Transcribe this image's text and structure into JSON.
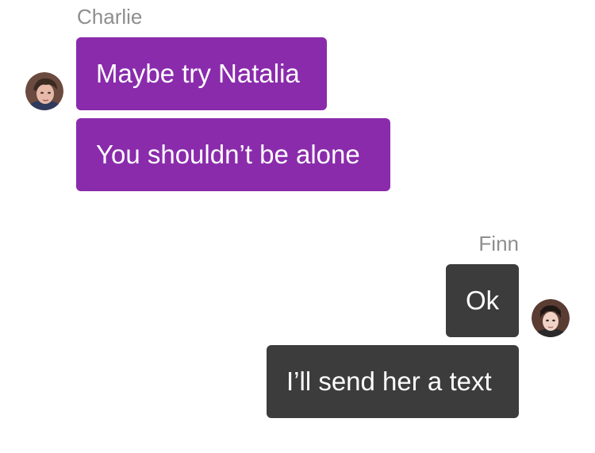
{
  "conversation": {
    "group_1": {
      "sender": "Charlie",
      "avatar_icon": "charlie-avatar-icon",
      "messages": [
        {
          "text": "Maybe try Natalia"
        },
        {
          "text": "You shouldn’t be alone"
        }
      ],
      "bubble_color": "#8a2bac"
    },
    "group_2": {
      "sender": "Finn",
      "avatar_icon": "finn-avatar-icon",
      "messages": [
        {
          "text": "Ok"
        },
        {
          "text": "I’ll send her a text"
        }
      ],
      "bubble_color": "#3c3c3c"
    }
  },
  "colors": {
    "sender_name": "#8e8e8e",
    "incoming_bubble": "#8a2bac",
    "outgoing_bubble": "#3c3c3c",
    "bubble_text": "#ffffff",
    "background": "#ffffff"
  }
}
